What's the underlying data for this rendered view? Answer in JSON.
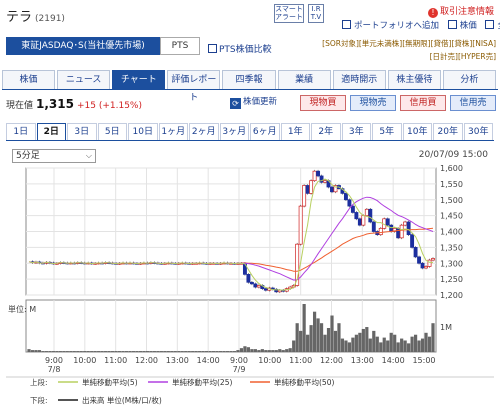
{
  "header": {
    "title": "テラ",
    "code": "(2191)",
    "smart_alert": "スマート\nアラート",
    "ir_tv": "I.R\nT.V",
    "alert_text": "取引注意情報",
    "portfolio": "ポートフォリオへ追加",
    "keiho": "株価",
    "zengara": "全板"
  },
  "market": {
    "selected": "東証JASDAQ･S(当社優先市場)",
    "pts_tab": "PTS",
    "pts_compare": "PTS株価比較",
    "tags_line1": "[SOR対象][単元未満株][無期限][貸借][貸株][NISA]",
    "tags_line2": "[日計売][HYPER売]"
  },
  "tabs": [
    {
      "label": "株価",
      "active": false
    },
    {
      "label": "ニュース",
      "active": false
    },
    {
      "label": "チャート",
      "active": true
    },
    {
      "label": "評価レポート",
      "active": false
    },
    {
      "label": "四季報",
      "active": false
    },
    {
      "label": "業績",
      "active": false
    },
    {
      "label": "適時開示",
      "active": false
    },
    {
      "label": "株主優待",
      "active": false
    },
    {
      "label": "分析",
      "active": false
    }
  ],
  "price": {
    "label": "現在値",
    "value": "1,315",
    "change": "+15 (+1.15%)",
    "update_button": "株価更新",
    "buy_spot": "現物買",
    "sell_spot": "現物売",
    "buy_margin": "信用買",
    "sell_margin": "信用売"
  },
  "periods": [
    "1日",
    "2日",
    "3日",
    "5日",
    "10日",
    "1ヶ月",
    "2ヶ月",
    "3ヶ月",
    "6ヶ月",
    "1年",
    "2年",
    "3年",
    "5年",
    "10年",
    "20年",
    "30年"
  ],
  "active_period": "2日",
  "interval": "5分足",
  "chart_date": "20/07/09 15:00",
  "chart_data": {
    "type": "line",
    "price_axis": {
      "ticks": [
        "1,600",
        "1,550",
        "1,500",
        "1,450",
        "1,400",
        "1,350",
        "1,300",
        "1,250",
        "1,200"
      ],
      "ylim": [
        1200,
        1600
      ]
    },
    "x_ticks": [
      "9:00",
      "10:00",
      "11:00",
      "12:00",
      "13:00",
      "14:00",
      "9:00",
      "10:00",
      "11:00",
      "12:00",
      "13:00",
      "14:00",
      "15:00"
    ],
    "x_date_labels": [
      {
        "under": 0,
        "text": "7/8"
      },
      {
        "under": 6,
        "text": "7/9"
      }
    ],
    "volume_unit_label": "単位: M",
    "volume_tick": "1M",
    "legend_upper_label": "上段:",
    "legend_lower_label": "下段:",
    "series": [
      {
        "name": "単純移動平均(5)",
        "color": "#b8d060"
      },
      {
        "name": "単純移動平均(25)",
        "color": "#b040e0"
      },
      {
        "name": "単純移動平均(50)",
        "color": "#f06030"
      }
    ],
    "volume_legend": "出来高 単位(M株/口/枚)",
    "candles_day1": [
      1305,
      1302,
      1304,
      1301,
      1300,
      1303,
      1301,
      1299,
      1300,
      1302,
      1301,
      1300,
      1301,
      1300,
      1302,
      1301,
      1300,
      1301,
      1299,
      1300,
      1301,
      1300,
      1302,
      1301,
      1300,
      1299,
      1300,
      1301,
      1300,
      1301,
      1300,
      1299,
      1300,
      1301,
      1300,
      1302,
      1301,
      1300,
      1299,
      1300,
      1301,
      1300,
      1299,
      1300,
      1301,
      1300,
      1299,
      1300,
      1300,
      1301,
      1300,
      1299,
      1300,
      1300,
      1299,
      1300,
      1301,
      1300,
      1300,
      1299,
      1300
    ],
    "candles_day2": [
      1300,
      1265,
      1240,
      1235,
      1225,
      1230,
      1220,
      1215,
      1222,
      1218,
      1210,
      1215,
      1212,
      1220,
      1225,
      1230,
      1360,
      1480,
      1545,
      1520,
      1560,
      1590,
      1575,
      1555,
      1560,
      1540,
      1525,
      1545,
      1535,
      1520,
      1500,
      1480,
      1460,
      1440,
      1420,
      1450,
      1470,
      1430,
      1400,
      1390,
      1410,
      1440,
      1420,
      1400,
      1410,
      1380,
      1420,
      1430,
      1390,
      1350,
      1320,
      1300,
      1285,
      1290,
      1310,
      1315
    ],
    "ma5": [
      1300,
      1298,
      1280,
      1262,
      1247,
      1236,
      1229,
      1224,
      1220,
      1217,
      1216,
      1216,
      1215,
      1217,
      1219,
      1224,
      1250,
      1303,
      1365,
      1421,
      1495,
      1540,
      1558,
      1560,
      1565,
      1560,
      1547,
      1540,
      1540,
      1533,
      1525,
      1513,
      1497,
      1477,
      1460,
      1450,
      1448,
      1444,
      1436,
      1428,
      1428,
      1422,
      1416,
      1412,
      1414,
      1410,
      1406,
      1408,
      1406,
      1396,
      1384,
      1360,
      1330,
      1309,
      1303,
      1302
    ],
    "ma25": [
      1300,
      1300,
      1299,
      1297,
      1294,
      1291,
      1287,
      1283,
      1279,
      1275,
      1271,
      1267,
      1262,
      1257,
      1252,
      1247,
      1248,
      1257,
      1270,
      1282,
      1296,
      1313,
      1330,
      1346,
      1362,
      1378,
      1394,
      1410,
      1426,
      1440,
      1456,
      1472,
      1485,
      1494,
      1500,
      1505,
      1508,
      1507,
      1503,
      1497,
      1488,
      1480,
      1473,
      1466,
      1458,
      1451,
      1447,
      1442,
      1436,
      1430,
      1422,
      1416,
      1412,
      1408,
      1404,
      1400
    ],
    "ma50": [
      1301,
      1301,
      1300,
      1300,
      1299,
      1298,
      1296,
      1294,
      1292,
      1290,
      1288,
      1286,
      1283,
      1280,
      1278,
      1275,
      1275,
      1278,
      1284,
      1290,
      1297,
      1303,
      1310,
      1317,
      1324,
      1331,
      1338,
      1345,
      1352,
      1360,
      1366,
      1372,
      1378,
      1382,
      1385,
      1388,
      1392,
      1394,
      1395,
      1396,
      1397,
      1398,
      1399,
      1400,
      1402,
      1403,
      1404,
      1405,
      1405,
      1406,
      1406,
      1407,
      1407,
      1408,
      1409,
      1410
    ],
    "volume_day1": [
      3,
      2,
      2,
      2,
      1,
      1,
      1,
      1,
      1,
      1,
      1,
      1,
      1,
      1,
      1,
      1,
      1,
      1,
      1,
      1,
      1,
      1,
      1,
      1,
      1,
      1,
      1,
      1,
      1,
      1,
      1,
      1,
      1,
      1,
      1,
      1,
      1,
      1,
      1,
      1,
      1,
      1,
      1,
      1,
      1,
      1,
      1,
      1,
      1,
      1,
      1,
      1,
      1,
      1,
      1,
      1,
      1,
      1,
      1,
      1,
      2
    ],
    "volume_day2": [
      4,
      6,
      5,
      3,
      3,
      2,
      3,
      2,
      2,
      2,
      2,
      3,
      2,
      3,
      4,
      12,
      30,
      22,
      50,
      18,
      28,
      42,
      35,
      30,
      18,
      25,
      38,
      22,
      30,
      14,
      12,
      10,
      15,
      18,
      20,
      24,
      26,
      14,
      22,
      16,
      10,
      15,
      12,
      20,
      18,
      10,
      14,
      12,
      9,
      16,
      18,
      12,
      14,
      20,
      16,
      30
    ]
  }
}
